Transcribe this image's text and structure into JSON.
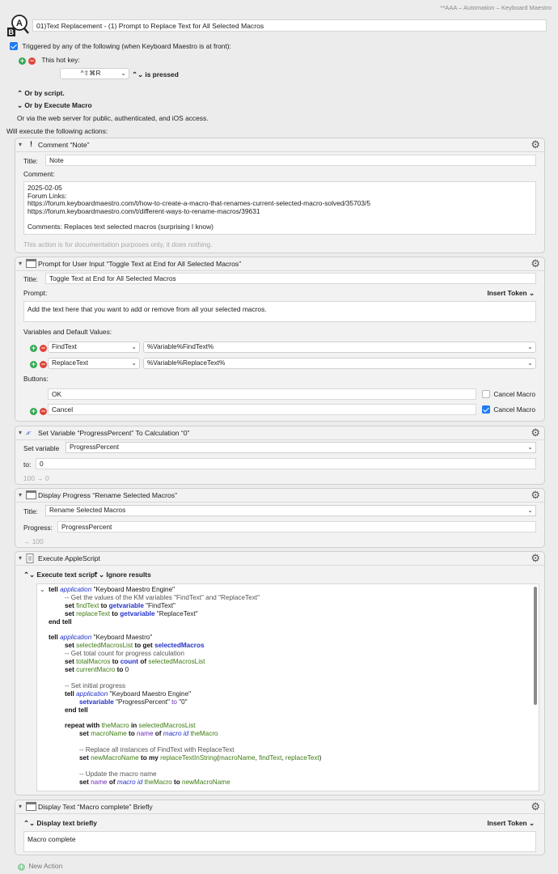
{
  "window": {
    "title": "**AAA – Automation – Keyboard Maestro"
  },
  "macro": {
    "name": "01)Text Replacement - (1) Prompt to Replace Text for All Selected Macros"
  },
  "triggers": {
    "enabled_label": "Triggered by any of the following (when Keyboard Maestro is at front):",
    "hotkey_label": "This hot key:",
    "hotkey": "^⇧⌘R",
    "hotkey_mode": "is pressed",
    "by_script": "Or by script.",
    "by_execute": "Or by Execute Macro",
    "web_server": "Or via the web server for public, authenticated, and iOS access."
  },
  "will_execute": "Will execute the following actions:",
  "actions": {
    "comment": {
      "header": "Comment “Note”",
      "title_label": "Title:",
      "title_value": "Note",
      "comment_label": "Comment:",
      "lines": [
        "2025-02-05",
        "Forum Links:",
        "https://forum.keyboardmaestro.com/t/how-to-create-a-macro-that-renames-current-selected-macro-solved/35703/5",
        "https://forum.keyboardmaestro.com/t/different-ways-to-rename-macros/39631",
        "",
        "Comments: Replaces text selected macros (surprising I know)"
      ],
      "footer": "This action is for documentation purposes only, it does nothing."
    },
    "prompt": {
      "header": "Prompt for User Input “Toggle Text at End for All Selected Macros”",
      "title_label": "Title:",
      "title_value": "Toggle Text at End for All Selected Macros",
      "prompt_label": "Prompt:",
      "insert_token": "Insert Token",
      "prompt_text": "Add the text here that you want to add or remove from all your selected macros.",
      "vars_label": "Variables and Default Values:",
      "var1_name": "FindText",
      "var1_default": "%Variable%FindText%",
      "var2_name": "ReplaceText",
      "var2_default": "%Variable%ReplaceText%",
      "buttons_label": "Buttons:",
      "btn1": "OK",
      "btn1_cancel": "Cancel Macro",
      "btn2": "Cancel",
      "btn2_cancel": "Cancel Macro"
    },
    "setvar": {
      "header": "Set Variable “ProgressPercent” To Calculation “0”",
      "set_label": "Set variable",
      "var_name": "ProgressPercent",
      "to_label": "to:",
      "to_value": "0",
      "footer": "100 → 0"
    },
    "progress": {
      "header": "Display Progress “Rename Selected Macros”",
      "title_label": "Title:",
      "title_value": "Rename Selected Macros",
      "progress_label": "Progress:",
      "progress_value": "ProgressPercent",
      "footer": "→ 100"
    },
    "applescript": {
      "header": "Execute AppleScript",
      "mode": "Execute text script",
      "results": "Ignore results"
    },
    "display": {
      "header": "Display Text “Macro complete” Briefly",
      "mode": "Display text briefly",
      "insert_token": "Insert Token",
      "text": "Macro complete"
    }
  },
  "new_action": "New Action",
  "icons": [
    "macro-icon",
    "gear-icon",
    "comment-icon",
    "window-icon",
    "variable-icon",
    "script-icon"
  ]
}
